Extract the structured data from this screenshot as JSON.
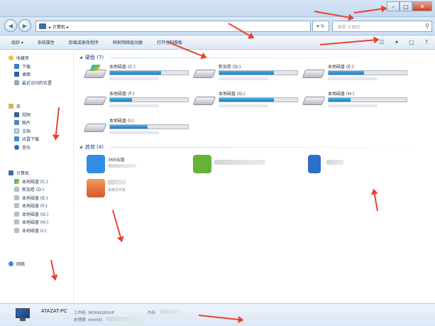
{
  "window": {
    "minimize": "–",
    "maximize": "□",
    "close": "✕"
  },
  "address": {
    "path": "▸ 计算机 ▸",
    "refresh": "▾ ↻",
    "search_placeholder": "搜索 计算机"
  },
  "toolbar": {
    "organize": "组织 ▾",
    "properties": "系统属性",
    "uninstall": "卸载或更改程序",
    "map_drive": "映射网络驱动器",
    "control_panel": "打开控制面板"
  },
  "sidebar": {
    "favorites": {
      "label": "收藏夹",
      "items": [
        "下载",
        "桌面",
        "最近访问的位置"
      ]
    },
    "library": {
      "label": "库",
      "items": [
        "视频",
        "图片",
        "文档",
        "迅雷下载",
        "音乐"
      ]
    },
    "computer": {
      "label": "计算机",
      "items": [
        "本地磁盘 (C:)",
        "新加卷 (D:)",
        "本地磁盘 (E:)",
        "本地磁盘 (F:)",
        "本地磁盘 (G:)",
        "本地磁盘 (H:)",
        "本地磁盘 (I:)"
      ]
    },
    "network": {
      "label": "网络"
    }
  },
  "content": {
    "drives_header": "硬盘 (7)",
    "drives": [
      {
        "name": "本地磁盘 (C:)",
        "used": 0.65,
        "system": true
      },
      {
        "name": "新加卷 (D:)",
        "used": 0.7,
        "system": false
      },
      {
        "name": "本地磁盘 (E:)",
        "used": 0.45,
        "system": false
      },
      {
        "name": "本地磁盘 (F:)",
        "used": 0.28,
        "system": false
      },
      {
        "name": "本地磁盘 (G:)",
        "used": 0.7,
        "system": false
      },
      {
        "name": "本地磁盘 (H:)",
        "used": 0.28,
        "system": false
      },
      {
        "name": "本地磁盘 (I:)",
        "used": 0.48,
        "system": false
      }
    ],
    "other_header": "其他 (4)",
    "other": [
      {
        "name": "360云盘",
        "sub": "",
        "color": "#2f8de4"
      },
      {
        "name": "",
        "sub": "",
        "color": "#66b33a"
      },
      {
        "name": "",
        "sub": "",
        "color": "#2a6fc9"
      },
      {
        "name": "",
        "sub": "系统文件夹",
        "color": "#e06a3a"
      }
    ]
  },
  "status": {
    "pc_name": "ATAZAT-PC",
    "workgroup": "工作组: WORKGROUP",
    "memory": "内存:",
    "processor": "处理器: Intel(R)"
  },
  "colors": {
    "arrow": "#e8432e",
    "accent": "#1a7dc0"
  }
}
